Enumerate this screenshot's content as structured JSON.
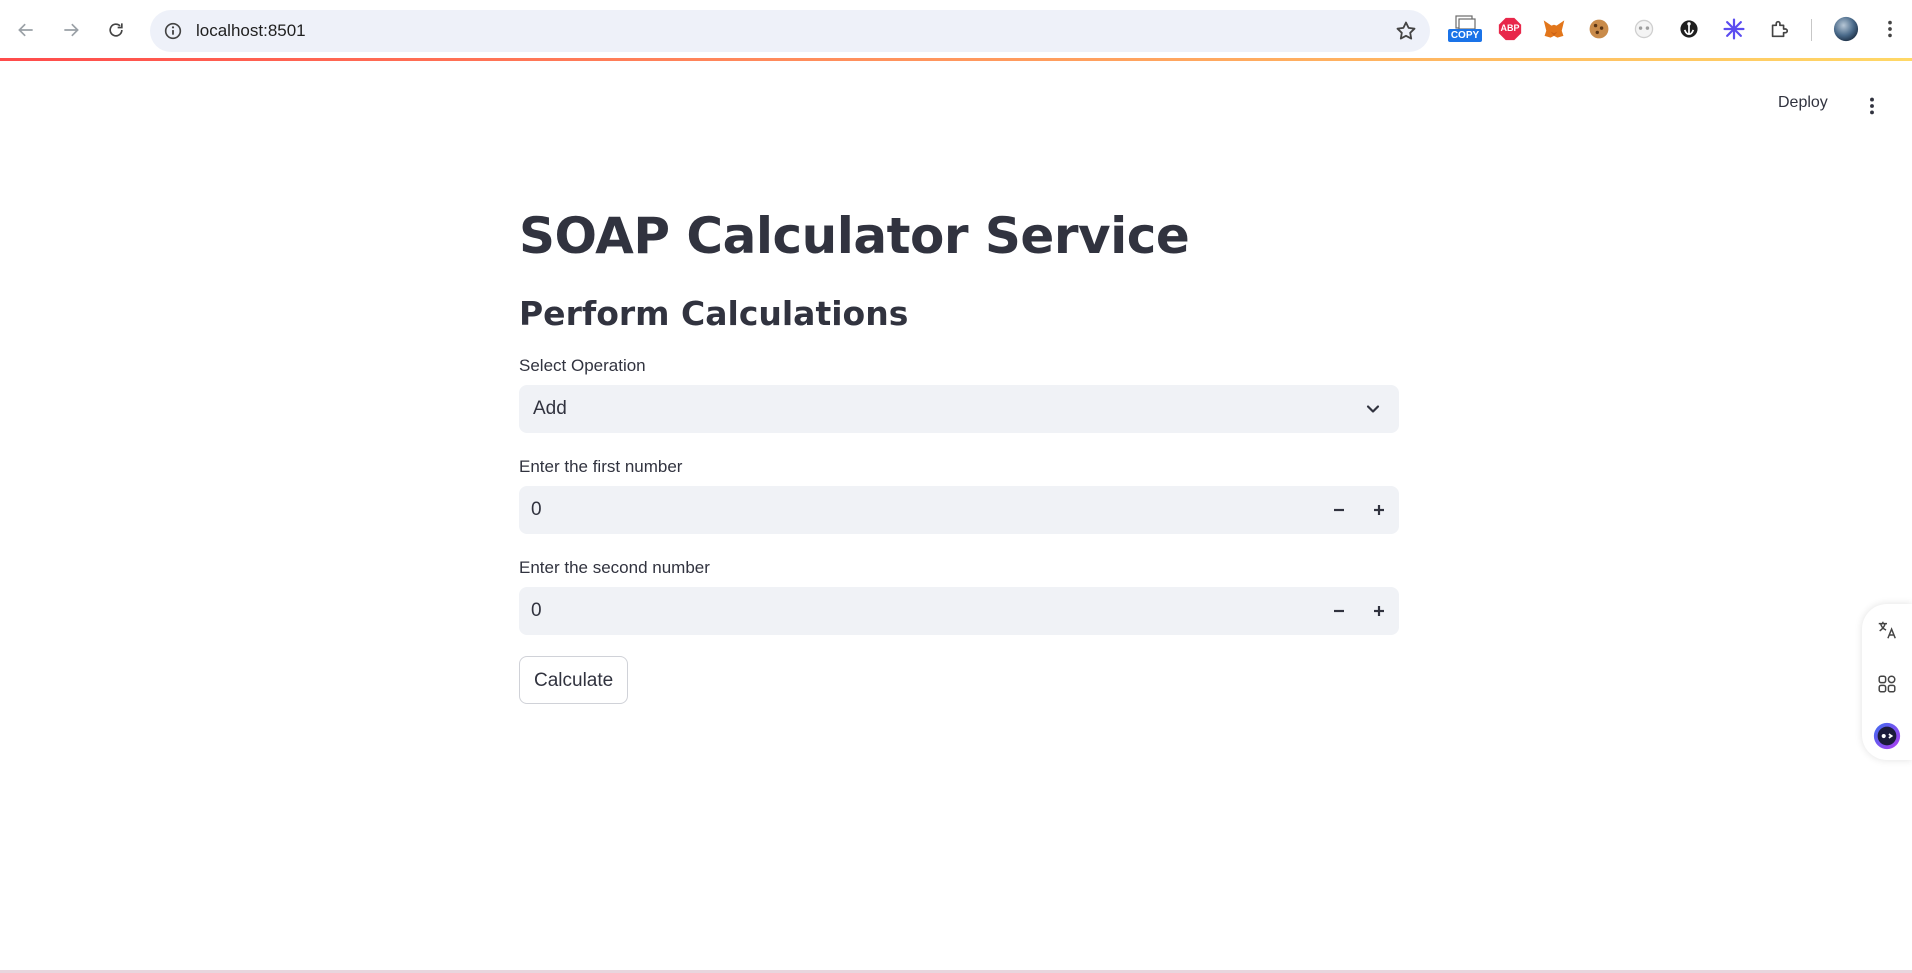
{
  "browser": {
    "url": "localhost:8501",
    "extensions": [
      "copy-icon",
      "adblock-icon",
      "metamask-icon",
      "cookie-icon",
      "panda-icon",
      "anchor-icon",
      "sparkle-icon",
      "puzzle-icon"
    ],
    "ext_copy_label": "COPY",
    "ext_abp_label": "ABP"
  },
  "header": {
    "deploy_label": "Deploy"
  },
  "main": {
    "title": "SOAP Calculator Service",
    "subtitle": "Perform Calculations",
    "operation": {
      "label": "Select Operation",
      "value": "Add"
    },
    "first_number": {
      "label": "Enter the first number",
      "value": "0"
    },
    "second_number": {
      "label": "Enter the second number",
      "value": "0"
    },
    "calculate_label": "Calculate"
  },
  "colors": {
    "accent_red": "#ff4b4b",
    "input_bg": "#f0f2f6",
    "text": "#31333f"
  }
}
